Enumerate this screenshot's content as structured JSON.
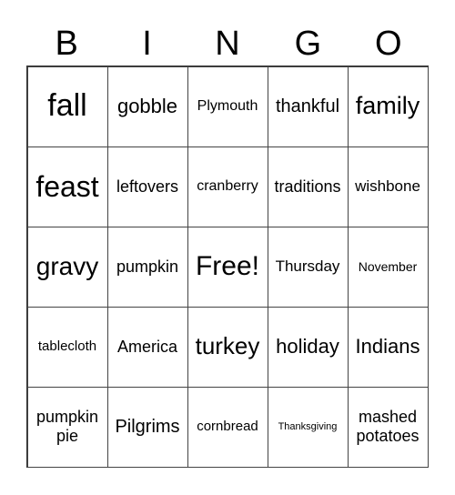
{
  "header": [
    "B",
    "I",
    "N",
    "G",
    "O"
  ],
  "cells": [
    {
      "text": "fall",
      "size": 34
    },
    {
      "text": "gobble",
      "size": 22
    },
    {
      "text": "Plymouth",
      "size": 16
    },
    {
      "text": "thankful",
      "size": 20
    },
    {
      "text": "family",
      "size": 27
    },
    {
      "text": "feast",
      "size": 32
    },
    {
      "text": "leftovers",
      "size": 18
    },
    {
      "text": "cranberry",
      "size": 16
    },
    {
      "text": "traditions",
      "size": 18
    },
    {
      "text": "wishbone",
      "size": 17
    },
    {
      "text": "gravy",
      "size": 28
    },
    {
      "text": "pumpkin",
      "size": 18
    },
    {
      "text": "Free!",
      "size": 30
    },
    {
      "text": "Thursday",
      "size": 17
    },
    {
      "text": "November",
      "size": 14
    },
    {
      "text": "tablecloth",
      "size": 15
    },
    {
      "text": "America",
      "size": 18
    },
    {
      "text": "turkey",
      "size": 26
    },
    {
      "text": "holiday",
      "size": 22
    },
    {
      "text": "Indians",
      "size": 22
    },
    {
      "text": "pumpkin pie",
      "size": 18
    },
    {
      "text": "Pilgrims",
      "size": 20
    },
    {
      "text": "cornbread",
      "size": 15
    },
    {
      "text": "Thanksgiving",
      "size": 11
    },
    {
      "text": "mashed potatoes",
      "size": 18
    }
  ]
}
